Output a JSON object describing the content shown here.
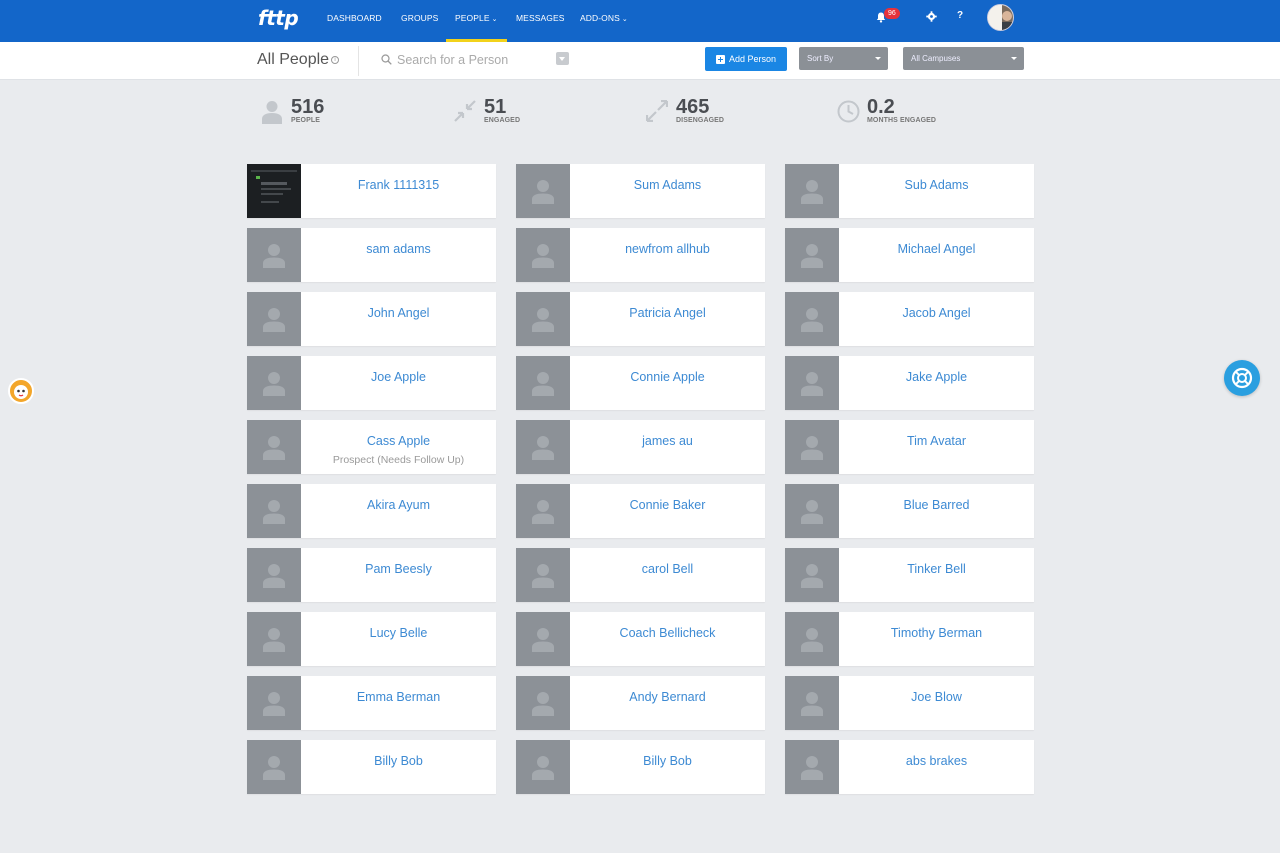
{
  "nav": {
    "logo": "fttp",
    "links": [
      {
        "label": "DASHBOARD",
        "caret": false
      },
      {
        "label": "GROUPS",
        "caret": false
      },
      {
        "label": "PEOPLE",
        "caret": true,
        "active": true
      },
      {
        "label": "MESSAGES",
        "caret": false
      },
      {
        "label": "ADD-ONS",
        "caret": true
      }
    ],
    "notification_count": "96",
    "help_label": "?",
    "icons": [
      "bell-icon",
      "gear-icon",
      "user-avatar"
    ]
  },
  "subheader": {
    "title": "All People",
    "search_placeholder": "Search for a Person",
    "add_person_label": "Add Person",
    "sort_by_label": "Sort By",
    "campuses_label": "All Campuses"
  },
  "stats": [
    {
      "value": "516",
      "label": "PEOPLE",
      "icon": "person-icon"
    },
    {
      "value": "51",
      "label": "ENGAGED",
      "icon": "compress-icon"
    },
    {
      "value": "465",
      "label": "DISENGAGED",
      "icon": "expand-icon"
    },
    {
      "value": "0.2",
      "label": "MONTHS ENGAGED",
      "icon": "clock-icon"
    }
  ],
  "people": [
    {
      "name": "Frank 1111315",
      "status": "",
      "photo": true
    },
    {
      "name": "Sum Adams",
      "status": ""
    },
    {
      "name": "Sub Adams",
      "status": ""
    },
    {
      "name": "sam adams",
      "status": ""
    },
    {
      "name": "newfrom allhub",
      "status": ""
    },
    {
      "name": "Michael Angel",
      "status": ""
    },
    {
      "name": "John Angel",
      "status": ""
    },
    {
      "name": "Patricia Angel",
      "status": ""
    },
    {
      "name": "Jacob Angel",
      "status": ""
    },
    {
      "name": "Joe Apple",
      "status": ""
    },
    {
      "name": "Connie Apple",
      "status": ""
    },
    {
      "name": "Jake Apple",
      "status": ""
    },
    {
      "name": "Cass Apple",
      "status": "Prospect (Needs Follow Up)"
    },
    {
      "name": "james au",
      "status": ""
    },
    {
      "name": "Tim Avatar",
      "status": ""
    },
    {
      "name": "Akira Ayum",
      "status": ""
    },
    {
      "name": "Connie Baker",
      "status": ""
    },
    {
      "name": "Blue Barred",
      "status": ""
    },
    {
      "name": "Pam Beesly",
      "status": ""
    },
    {
      "name": "carol Bell",
      "status": ""
    },
    {
      "name": "Tinker Bell",
      "status": ""
    },
    {
      "name": "Lucy Belle",
      "status": ""
    },
    {
      "name": "Coach Bellicheck",
      "status": ""
    },
    {
      "name": "Timothy Berman",
      "status": ""
    },
    {
      "name": "Emma Berman",
      "status": ""
    },
    {
      "name": "Andy Bernard",
      "status": ""
    },
    {
      "name": "Joe Blow",
      "status": ""
    },
    {
      "name": "Billy Bob",
      "status": ""
    },
    {
      "name": "Billy Bob",
      "status": ""
    },
    {
      "name": "abs brakes",
      "status": ""
    }
  ],
  "colors": {
    "nav_bg": "#1366c9",
    "accent": "#1a86e4",
    "link": "#3d8ad3",
    "badge": "#e5323b",
    "active_underline": "#f2d21b"
  }
}
